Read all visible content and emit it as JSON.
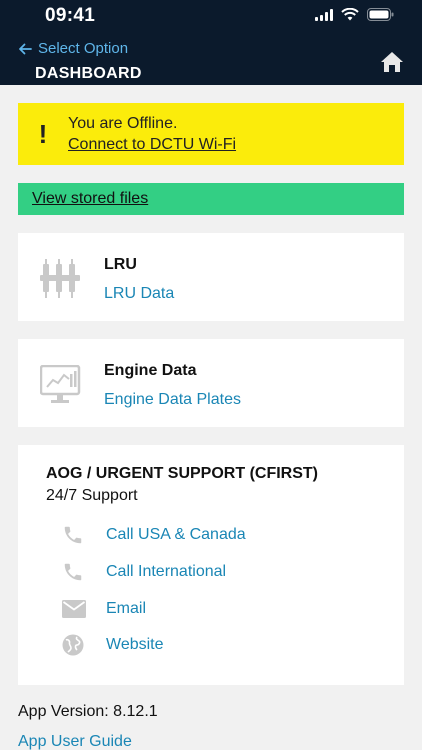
{
  "status_bar": {
    "time": "09:41"
  },
  "nav": {
    "back_label": "Select Option",
    "title": "DASHBOARD"
  },
  "offline_banner": {
    "icon": "exclamation-icon",
    "message": "You are Offline.",
    "link": "Connect to DCTU Wi-Fi"
  },
  "stored_files": {
    "label": "View stored files"
  },
  "cards": {
    "lru": {
      "icon": "lru-connector-icon",
      "title": "LRU",
      "link": "LRU Data"
    },
    "engine": {
      "icon": "monitor-chart-icon",
      "title": "Engine Data",
      "link": "Engine Data Plates"
    }
  },
  "support": {
    "title": "AOG / URGENT SUPPORT (CFIRST)",
    "subtitle": "24/7 Support",
    "items": [
      {
        "icon": "phone-icon",
        "label": "Call USA & Canada"
      },
      {
        "icon": "phone-icon",
        "label": "Call International"
      },
      {
        "icon": "mail-icon",
        "label": "Email"
      },
      {
        "icon": "globe-icon",
        "label": "Website"
      }
    ]
  },
  "footer": {
    "version": "App Version: 8.12.1",
    "guide": "App User Guide"
  },
  "colors": {
    "header_bg": "#0b1a2c",
    "accent_link": "#1a86b5",
    "banner_yellow": "#fbec0b",
    "banner_green": "#33cf84"
  }
}
